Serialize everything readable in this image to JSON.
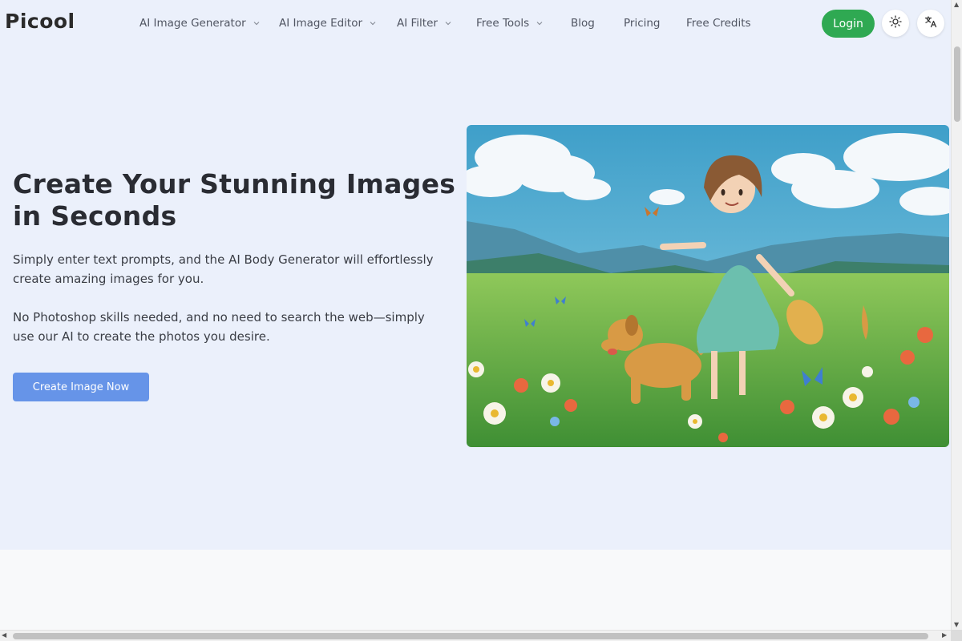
{
  "brand": {
    "logo": "Picool"
  },
  "nav": {
    "items": [
      {
        "label": "AI Image Generator",
        "dropdown": true
      },
      {
        "label": "AI Image Editor",
        "dropdown": true
      },
      {
        "label": "AI Filter",
        "dropdown": true
      },
      {
        "label": "Free Tools",
        "dropdown": true
      },
      {
        "label": "Blog",
        "dropdown": false
      },
      {
        "label": "Pricing",
        "dropdown": false
      },
      {
        "label": "Free Credits",
        "dropdown": false
      }
    ],
    "login_label": "Login",
    "theme_icon": "sun-icon",
    "language_icon": "translate-icon"
  },
  "hero": {
    "title": "Create Your Stunning Images in Seconds",
    "paragraph1": "Simply enter text prompts, and the AI Body Generator will effortlessly create amazing images for you.",
    "paragraph2": "No Photoshop skills needed, and no need to search the web—simply use our AI to create the photos you desire.",
    "cta_label": "Create Image Now"
  },
  "colors": {
    "accent_green": "#2fa952",
    "cta_blue": "#6694e8",
    "hero_bg": "#ebf0fb"
  }
}
